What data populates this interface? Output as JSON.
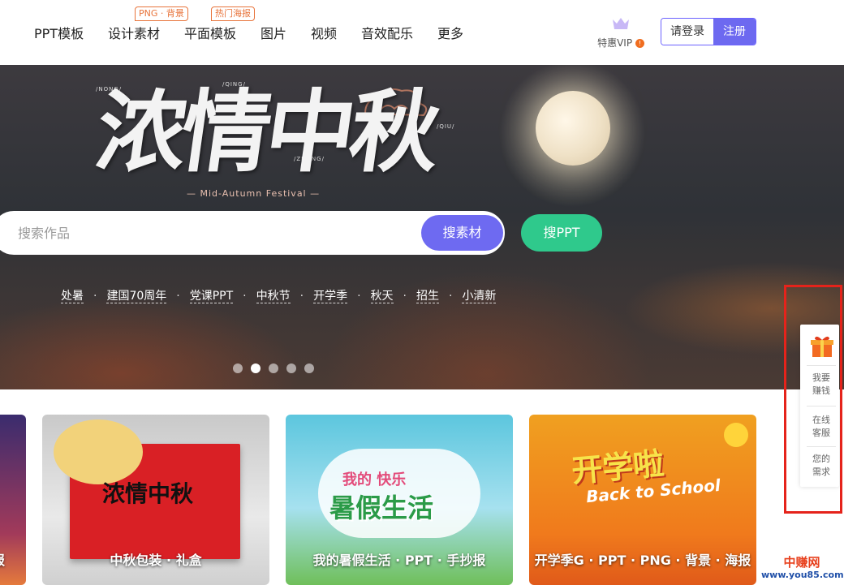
{
  "nav": {
    "items": [
      "PPT模板",
      "设计素材",
      "平面模板",
      "图片",
      "视频",
      "音效配乐",
      "更多"
    ],
    "tags": {
      "design": "PNG · 背景",
      "poster": "热门海报"
    },
    "vip_label": "特惠VIP",
    "vip_badge": "!",
    "login": "请登录",
    "register": "注册"
  },
  "hero": {
    "title": "浓情中秋",
    "subtitle": "— Mid-Autumn Festival —",
    "pinyin": [
      "/NONG/",
      "/QING/",
      "/ZHONG/",
      "/QIU/"
    ],
    "search_placeholder": "搜索作品",
    "search_button": "搜素材",
    "ppt_button": "搜PPT",
    "hot_keywords": [
      "处暑",
      "建国70周年",
      "党课PPT",
      "中秋节",
      "开学季",
      "秋天",
      "招生",
      "小清新"
    ],
    "slide_count": 5,
    "active_slide": 2
  },
  "cards": [
    {
      "label": "报"
    },
    {
      "label": "中秋包装 · 礼盒",
      "art_text": "浓情中秋"
    },
    {
      "label": "我的暑假生活 · PPT · 手抄报",
      "art_top": "我的 快乐",
      "art_main": "暑假生活"
    },
    {
      "label": "开学季G · PPT · PNG · 背景 · 海报",
      "art_main": "开学啦",
      "art_en": "Back to School"
    }
  ],
  "side_panel": {
    "items": [
      "我要\n赚钱",
      "在线\n客服",
      "您的\n需求"
    ]
  },
  "watermark": {
    "cn": "中赚网",
    "url": "www.you85.com"
  },
  "colors": {
    "accent": "#6d69f0",
    "green": "#2fc98c",
    "tag_orange": "#e8743b",
    "highlight_red": "#e5231b"
  }
}
